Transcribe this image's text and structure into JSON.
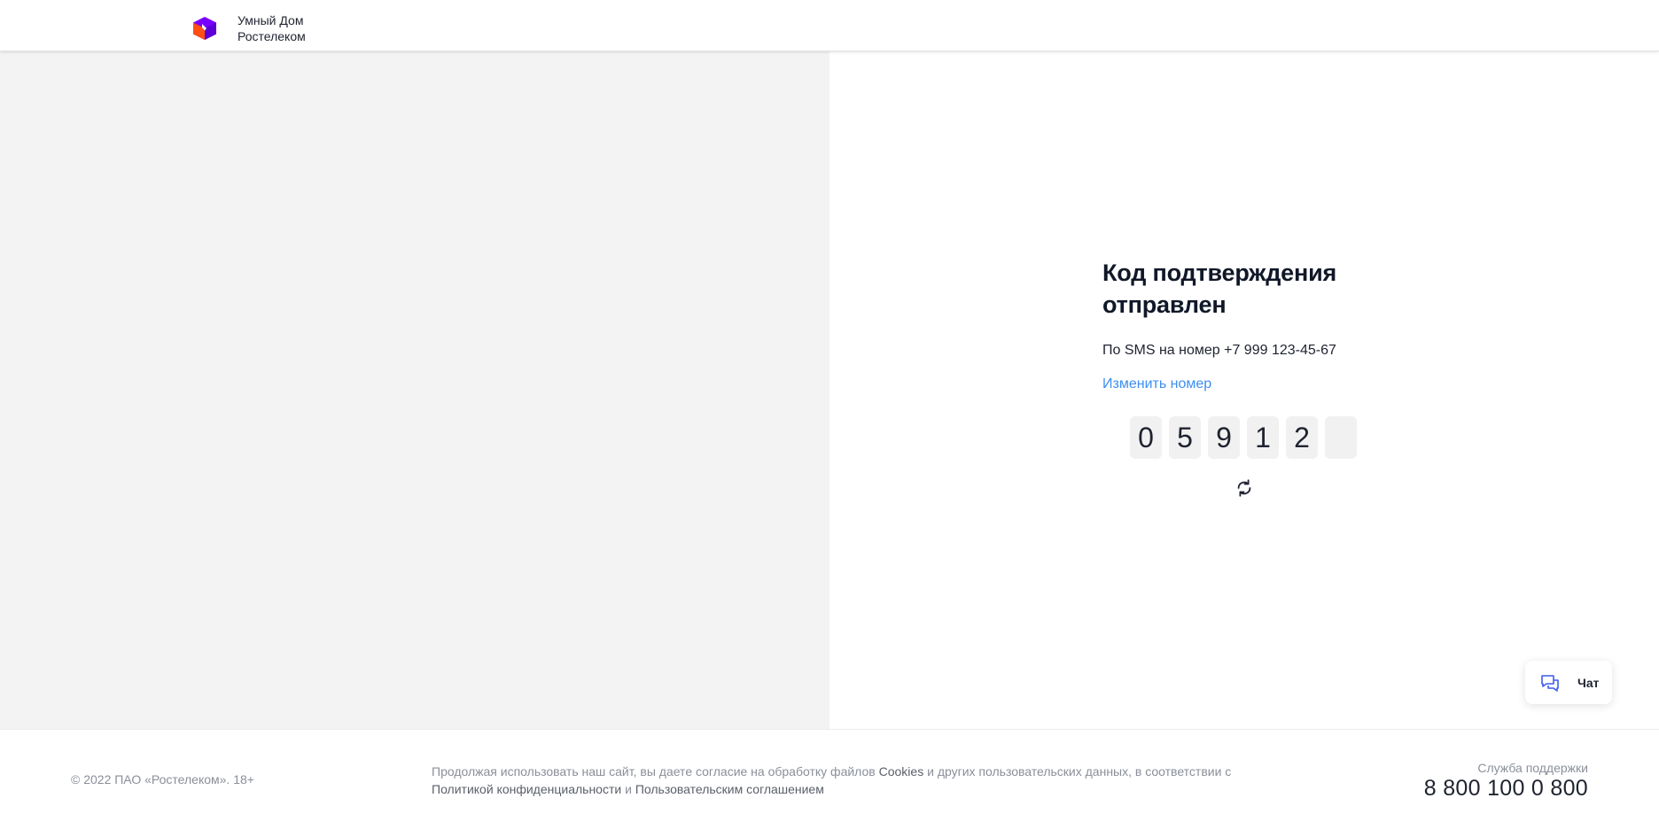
{
  "header": {
    "logo_line1": "Умный Дом",
    "logo_line2": "Ростелеком",
    "logo_icon": "rostelecom-cube-icon",
    "brand_colors": {
      "orange": "#ff4f12",
      "purple": "#7700ff"
    }
  },
  "verification": {
    "title": "Код подтверждения отправлен",
    "sms_text": "По SMS на номер +7 999 123-45-67",
    "change_number_label": "Изменить номер",
    "code_digits": [
      "0",
      "5",
      "9",
      "1",
      "2",
      ""
    ],
    "refresh_icon": "refresh-icon"
  },
  "chat": {
    "label": "Чат",
    "icon": "chat-bubbles-icon"
  },
  "footer": {
    "copyright": "© 2022 ПАО «Ростелеком». 18+",
    "consent_prefix": "Продолжая использовать наш сайт, вы даете согласие на обработку файлов ",
    "cookies_link": "Cookies",
    "consent_middle": " и других пользовательских данных, в соответствии с ",
    "privacy_link": "Политикой конфиденциальности",
    "consent_and": " и ",
    "agreement_link": "Пользовательским соглашением",
    "support_label": "Служба поддержки",
    "support_phone": "8 800 100 0 800"
  },
  "colors": {
    "link": "#3d8ef0",
    "left_panel_bg": "#f3f3f3",
    "code_cell_bg": "#f1f1f1",
    "chat_icon": "#3d5cf0"
  }
}
